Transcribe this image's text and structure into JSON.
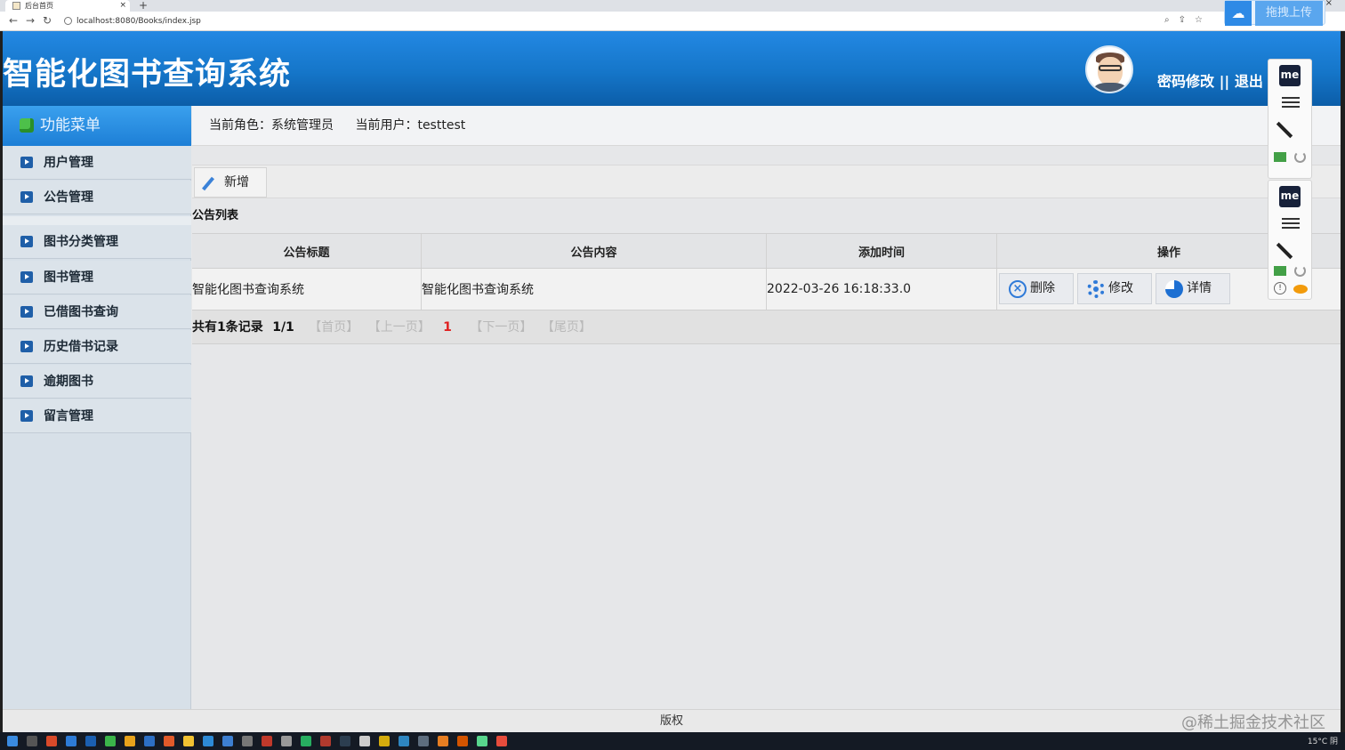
{
  "browser": {
    "tab_title": "后台首页",
    "url": "localhost:8080/Books/index.jsp",
    "upload_label": "拖拽上传"
  },
  "header": {
    "system_title": "智能化图书查询系统",
    "links": "密码修改 || 退出"
  },
  "sidebar": {
    "menu_title": "功能菜单",
    "items": [
      {
        "label": "用户管理"
      },
      {
        "label": "公告管理"
      },
      {
        "label": "图书分类管理"
      },
      {
        "label": "图书管理"
      },
      {
        "label": "已借图书查询"
      },
      {
        "label": "历史借书记录"
      },
      {
        "label": "逾期图书"
      },
      {
        "label": "留言管理"
      }
    ]
  },
  "infobar": {
    "role": "当前角色：系统管理员",
    "user": "当前用户：testtest"
  },
  "toolbar": {
    "add_label": "新增"
  },
  "list": {
    "title": "公告列表",
    "columns": [
      "公告标题",
      "公告内容",
      "添加时间",
      "操作"
    ],
    "rows": [
      {
        "title": "智能化图书查询系统",
        "content": "智能化图书查询系统",
        "time": "2022-03-26 16:18:33.0"
      }
    ],
    "actions": {
      "delete": "删除",
      "edit": "修改",
      "detail": "详情"
    }
  },
  "pager": {
    "total": "共有1条记录",
    "pages": "1/1",
    "first": "【首页】",
    "prev": "【上一页】",
    "current": "1",
    "next": "【下一页】",
    "last": "【尾页】"
  },
  "footer": {
    "copyright": "版权"
  },
  "watermark": "@稀土掘金技术社区",
  "ext": {
    "logo": "me"
  },
  "taskbar": {
    "tray": "15°C 阴"
  },
  "colors": {
    "header_blue": "#1576c9",
    "accent": "#2f7ad8",
    "current_page": "#e02020"
  }
}
